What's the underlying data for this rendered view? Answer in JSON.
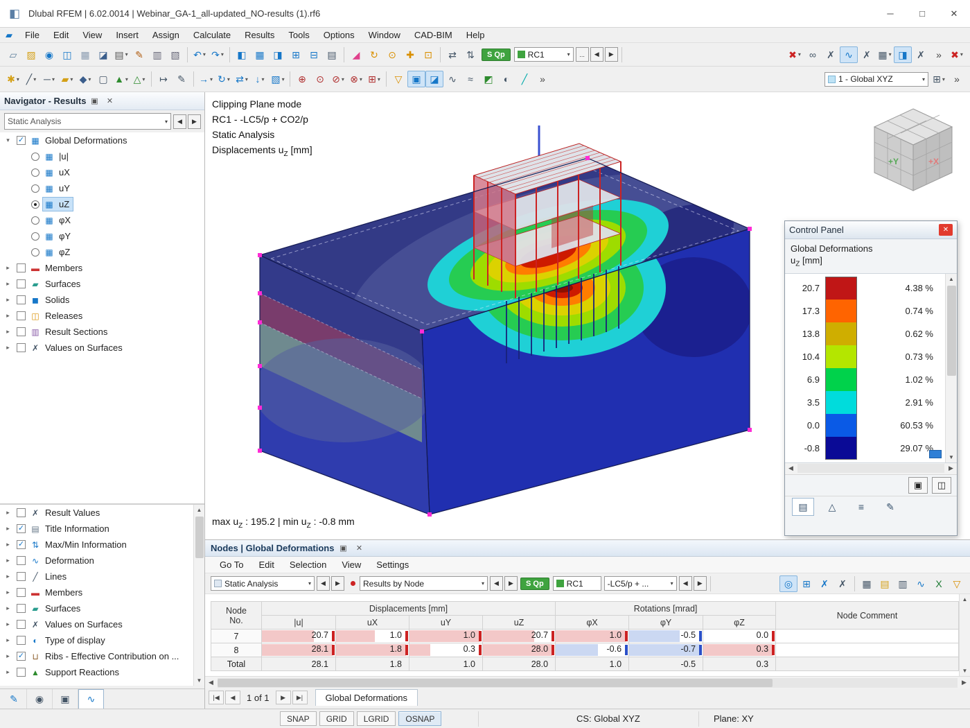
{
  "window": {
    "title": "Dlubal RFEM | 6.02.0014 | Webinar_GA-1_all-updated_NO-results (1).rf6",
    "minimize": "─",
    "maximize": "□",
    "close": "✕"
  },
  "menus": [
    "File",
    "Edit",
    "View",
    "Insert",
    "Assign",
    "Calculate",
    "Results",
    "Tools",
    "Options",
    "Window",
    "CAD-BIM",
    "Help"
  ],
  "toolbar_widgets": {
    "sqp": "S Qp",
    "rc1": "RC1",
    "ellipsis": "...",
    "prev": "◀",
    "next": "▶",
    "gxyz": "1 - Global XYZ"
  },
  "toolbar1a": [
    {
      "name": "new-model-icon",
      "glyph": "▱",
      "color": "#5a7d9a"
    },
    {
      "name": "open-model-icon",
      "glyph": "▨",
      "color": "#d4a017"
    },
    {
      "name": "dlubal-connect-icon",
      "glyph": "◉",
      "color": "#1677c8"
    },
    {
      "name": "model-manager-icon",
      "glyph": "◫",
      "color": "#1677c8"
    },
    {
      "name": "printout-gallery-icon",
      "glyph": "▦",
      "color": "#8a9bb0"
    },
    {
      "name": "save-icon",
      "glyph": "◪",
      "color": "#3b5e8c"
    },
    {
      "name": "print-icon",
      "glyph": "▤",
      "color": "#555555",
      "dd": true
    },
    {
      "name": "edit-report-icon",
      "glyph": "✎",
      "color": "#b05c10"
    },
    {
      "name": "printout-report-icon",
      "glyph": "▥",
      "color": "#666677"
    },
    {
      "name": "report-preview-icon",
      "glyph": "▧",
      "color": "#666677"
    },
    {
      "sep": true
    },
    {
      "name": "undo-icon",
      "glyph": "↶",
      "color": "#1677c8",
      "dd": true
    },
    {
      "name": "redo-icon",
      "glyph": "↷",
      "color": "#1677c8",
      "dd": true
    },
    {
      "sep": true
    },
    {
      "name": "navigator-panel-icon",
      "glyph": "◧",
      "color": "#1677c8"
    },
    {
      "name": "tables-panel-icon",
      "glyph": "▦",
      "color": "#1677c8"
    },
    {
      "name": "side-panel-icon",
      "glyph": "◨",
      "color": "#1677c8"
    },
    {
      "name": "result-tables-icon",
      "glyph": "⊞",
      "color": "#1677c8"
    },
    {
      "name": "sc-tables-icon",
      "glyph": "⊟",
      "color": "#1677c8"
    },
    {
      "name": "all-tables-icon",
      "glyph": "▤",
      "color": "#445566"
    },
    {
      "sep": true
    },
    {
      "name": "clip-select-icon",
      "glyph": "◢",
      "color": "#e0418c"
    },
    {
      "name": "rotate-view-icon",
      "glyph": "↻",
      "color": "#d98f00"
    },
    {
      "name": "zoom-view-icon",
      "glyph": "⊙",
      "color": "#d98f00"
    },
    {
      "name": "pan-view-icon",
      "glyph": "✚",
      "color": "#d98f00"
    },
    {
      "name": "zoom-window-icon",
      "glyph": "⊡",
      "color": "#d98f00"
    },
    {
      "sep": true
    },
    {
      "name": "renumber-icon",
      "glyph": "⇄",
      "color": "#445566"
    },
    {
      "name": "generate-numbering-icon",
      "glyph": "⇅",
      "color": "#445566"
    }
  ],
  "toolbar1b": [
    {
      "name": "delete-results-icon",
      "glyph": "✖",
      "color": "#cc2222",
      "dd": true
    },
    {
      "name": "calculation-link-icon",
      "glyph": "∞",
      "color": "#445566"
    },
    {
      "name": "result-values-xxx-icon",
      "glyph": "✗",
      "color": "#445566"
    },
    {
      "name": "show-results-icon",
      "glyph": "∿",
      "color": "#1677c8",
      "active": true
    },
    {
      "name": "result-xxx-icon",
      "glyph": "✗",
      "color": "#445566"
    },
    {
      "name": "result-grid-icon",
      "glyph": "▦",
      "color": "#445566",
      "dd": true
    },
    {
      "name": "show-panel-icon",
      "glyph": "◨",
      "color": "#1677c8",
      "active": true
    },
    {
      "name": "values-xxx-icon",
      "glyph": "✗",
      "color": "#445566"
    },
    {
      "name": "toolbar-overflow-icon",
      "glyph": "»",
      "color": "#444444"
    },
    {
      "name": "stop-calculation-icon",
      "glyph": "✖",
      "color": "#cc2222",
      "dd": true
    }
  ],
  "toolbar2a": [
    {
      "name": "new-node-icon",
      "glyph": "✱",
      "color": "#d4a017",
      "dd": true
    },
    {
      "name": "new-line-icon",
      "glyph": "╱",
      "color": "#445566",
      "dd": true
    },
    {
      "name": "new-member-icon",
      "glyph": "─",
      "color": "#445566",
      "dd": true
    },
    {
      "name": "new-surface-icon",
      "glyph": "▰",
      "color": "#d4a017",
      "dd": true
    },
    {
      "name": "new-solid-icon",
      "glyph": "◆",
      "color": "#3b5e8c",
      "dd": true
    },
    {
      "name": "new-opening-icon",
      "glyph": "▢",
      "color": "#445566"
    },
    {
      "name": "new-support-icon",
      "glyph": "▲",
      "color": "#2e8b2e",
      "dd": true
    },
    {
      "name": "new-hinge-icon",
      "glyph": "△",
      "color": "#2e8b2e",
      "dd": true
    },
    {
      "sep": true
    },
    {
      "name": "dimension-icon",
      "glyph": "↦",
      "color": "#445566"
    },
    {
      "name": "annotation-icon",
      "glyph": "✎",
      "color": "#445566"
    },
    {
      "sep": true
    },
    {
      "name": "move-copy-icon",
      "glyph": "→",
      "color": "#1677c8",
      "dd": true
    },
    {
      "name": "rotate-icon",
      "glyph": "↻",
      "color": "#1677c8",
      "dd": true
    },
    {
      "name": "mirror-icon",
      "glyph": "⇄",
      "color": "#1677c8",
      "dd": true
    },
    {
      "name": "project-icon",
      "glyph": "↓",
      "color": "#1677c8",
      "dd": true
    },
    {
      "name": "extrude-icon",
      "glyph": "▧",
      "color": "#1677c8",
      "dd": true
    },
    {
      "sep": true
    },
    {
      "name": "snap-nodes-icon",
      "glyph": "⊕",
      "color": "#b03030"
    },
    {
      "name": "merge-nodes-icon",
      "glyph": "⊙",
      "color": "#b03030"
    },
    {
      "name": "divide-lines-icon",
      "glyph": "⊘",
      "color": "#b03030",
      "dd": true
    },
    {
      "name": "intersect-icon",
      "glyph": "⊗",
      "color": "#b03030",
      "dd": true
    },
    {
      "name": "connect-members-icon",
      "glyph": "⊞",
      "color": "#b03030",
      "dd": true
    },
    {
      "sep": true
    },
    {
      "name": "visibility-filter-icon",
      "glyph": "▽",
      "color": "#d98f00"
    },
    {
      "name": "clipping-box-icon",
      "glyph": "▣",
      "color": "#1677c8",
      "active": true
    },
    {
      "name": "clipping-plane-icon",
      "glyph": "◪",
      "color": "#1677c8",
      "active": true
    },
    {
      "name": "result-diagrams-icon",
      "glyph": "∿",
      "color": "#445566"
    },
    {
      "name": "smooth-contours-icon",
      "glyph": "≈",
      "color": "#445566"
    },
    {
      "name": "rendering-icon",
      "glyph": "◩",
      "color": "#2e8b2e"
    },
    {
      "name": "display-settings-icon",
      "glyph": "◐",
      "color": "#445566"
    },
    {
      "name": "paintbrush-icon",
      "glyph": "╱",
      "color": "#00aaaa"
    },
    {
      "name": "toolbar2-overflow-icon",
      "glyph": "»",
      "color": "#444444"
    }
  ],
  "toolbar2b": [
    {
      "name": "visual-objects-icon",
      "glyph": "⊞",
      "color": "#445566",
      "dd": true
    },
    {
      "name": "toolbar2-overflow2-icon",
      "glyph": "»",
      "color": "#444444"
    }
  ],
  "navigator": {
    "title": "Navigator - Results",
    "combo": "Static Analysis",
    "tree": [
      {
        "label": "Global Deformations",
        "expanded": true,
        "checked": true,
        "icon": "▦",
        "icolor": "#1677c8",
        "children": [
          {
            "label": "|u|",
            "radio": false
          },
          {
            "label": "uX",
            "radio": false
          },
          {
            "label": "uY",
            "radio": false
          },
          {
            "label": "uZ",
            "radio": true,
            "selected": true
          },
          {
            "label": "φX",
            "radio": false
          },
          {
            "label": "φY",
            "radio": false
          },
          {
            "label": "φZ",
            "radio": false
          }
        ]
      },
      {
        "label": "Members",
        "checked": false,
        "icon": "▬",
        "icolor": "#cc3333"
      },
      {
        "label": "Surfaces",
        "checked": false,
        "icon": "▰",
        "icolor": "#2a9d8f"
      },
      {
        "label": "Solids",
        "checked": false,
        "icon": "◼",
        "icolor": "#1677c8"
      },
      {
        "label": "Releases",
        "checked": false,
        "icon": "◫",
        "icolor": "#d98f00"
      },
      {
        "label": "Result Sections",
        "checked": false,
        "icon": "▥",
        "icolor": "#8a5ca8"
      },
      {
        "label": "Values on Surfaces",
        "checked": false,
        "icon": "✗",
        "icolor": "#445566"
      }
    ],
    "tree2": [
      {
        "label": "Result Values",
        "checked": false,
        "icon": "✗",
        "icolor": "#445566"
      },
      {
        "label": "Title Information",
        "checked": true,
        "icon": "▤",
        "icolor": "#667788"
      },
      {
        "label": "Max/Min Information",
        "checked": true,
        "icon": "⇅",
        "icolor": "#1677c8"
      },
      {
        "label": "Deformation",
        "checked": false,
        "icon": "∿",
        "icolor": "#1677c8"
      },
      {
        "label": "Lines",
        "checked": false,
        "icon": "╱",
        "icolor": "#445566"
      },
      {
        "label": "Members",
        "checked": false,
        "icon": "▬",
        "icolor": "#cc3333"
      },
      {
        "label": "Surfaces",
        "checked": false,
        "icon": "▰",
        "icolor": "#2a9d8f"
      },
      {
        "label": "Values on Surfaces",
        "checked": false,
        "icon": "✗",
        "icolor": "#445566"
      },
      {
        "label": "Type of display",
        "checked": false,
        "icon": "◐",
        "icolor": "#1677c8"
      },
      {
        "label": "Ribs - Effective Contribution on ...",
        "checked": true,
        "icon": "⊔",
        "icolor": "#8a5c28"
      },
      {
        "label": "Support Reactions",
        "checked": false,
        "icon": "▲",
        "icolor": "#2e8b2e"
      }
    ],
    "tabs": [
      {
        "name": "data-navigator-tab",
        "glyph": "✎",
        "color": "#1677c8"
      },
      {
        "name": "display-navigator-tab",
        "glyph": "◉",
        "color": "#445566"
      },
      {
        "name": "views-navigator-tab",
        "glyph": "▣",
        "color": "#445566"
      },
      {
        "name": "results-navigator-tab",
        "glyph": "∿",
        "color": "#1677c8",
        "active": true
      }
    ]
  },
  "viewport": {
    "info1": "Clipping Plane mode",
    "info2": "RC1 - -LC5/p + CO2/p",
    "info3": "Static Analysis",
    "info4_pre": "Displacements u",
    "info4_sub": "Z",
    "info4_post": " [mm]",
    "max_pre": "max u",
    "max_sub": "Z",
    "max_mid": " : 195.2 | min u",
    "max_sub2": "Z",
    "max_post": " : -0.8 mm",
    "cube_x": "+X",
    "cube_y": "+Y"
  },
  "control_panel": {
    "title": "Control Panel",
    "subtitle1": "Global Deformations",
    "subtitle2_pre": "u",
    "subtitle2_sub": "Z",
    "subtitle2_post": " [mm]",
    "scale": [
      {
        "value": "20.7",
        "color": "#c01616",
        "percent": "4.38 %"
      },
      {
        "value": "17.3",
        "color": "#ff6400",
        "percent": "0.74 %"
      },
      {
        "value": "13.8",
        "color": "#cfae00",
        "percent": "0.62 %"
      },
      {
        "value": "10.4",
        "color": "#b4e600",
        "percent": "0.73 %"
      },
      {
        "value": "6.9",
        "color": "#00d24b",
        "percent": "1.02 %"
      },
      {
        "value": "3.5",
        "color": "#00dcdc",
        "percent": "2.91 %"
      },
      {
        "value": "0.0",
        "color": "#0a5ae6",
        "percent": "60.53 %"
      },
      {
        "value": "-0.8",
        "color": "#0a0a96",
        "percent": "29.07 %"
      }
    ],
    "buttons": [
      {
        "name": "copy-panel-icon",
        "glyph": "▣"
      },
      {
        "name": "panel-options-icon",
        "glyph": "◫"
      }
    ],
    "tabs": [
      {
        "name": "color-scale-tab",
        "glyph": "▤",
        "active": true
      },
      {
        "name": "factors-tab",
        "glyph": "△"
      },
      {
        "name": "filter-tab",
        "glyph": "≡"
      },
      {
        "name": "edit-scale-tab",
        "glyph": "✎"
      }
    ]
  },
  "table_panel": {
    "title": "Nodes | Global Deformations",
    "menu": [
      "Go To",
      "Edit",
      "Selection",
      "View",
      "Settings"
    ],
    "combo1": "Static Analysis",
    "combo2": "Results by Node",
    "badge": "S Qp",
    "combo3": "RC1",
    "combo4": "-LC5/p + ...",
    "toolbar_icons": [
      {
        "name": "find-node-icon",
        "glyph": "◎",
        "color": "#1677c8",
        "active": true
      },
      {
        "name": "sync-views-icon",
        "glyph": "⊞",
        "color": "#1677c8"
      },
      {
        "name": "show-values-icon",
        "glyph": "✗",
        "color": "#1677c8"
      },
      {
        "name": "xxx-values-icon",
        "glyph": "✗",
        "color": "#445566"
      },
      {
        "sep": true
      },
      {
        "name": "table-settings-icon",
        "glyph": "▦",
        "color": "#445566"
      },
      {
        "name": "table-colors-icon",
        "glyph": "▤",
        "color": "#d4a017"
      },
      {
        "name": "table-print-icon",
        "glyph": "▥",
        "color": "#445566"
      },
      {
        "name": "table-diagram-icon",
        "glyph": "∿",
        "color": "#1677c8"
      },
      {
        "name": "export-excel-icon",
        "glyph": "X",
        "color": "#1e7b34"
      },
      {
        "name": "table-filter-icon",
        "glyph": "▽",
        "color": "#d98f00"
      }
    ],
    "headers": {
      "node": "Node",
      "no": "No.",
      "displacements": "Displacements [mm]",
      "rotations": "Rotations [mrad]",
      "comment": "Node Comment",
      "cols": [
        "|u|",
        "uX",
        "uY",
        "uZ",
        "φX",
        "φY",
        "φZ"
      ]
    },
    "rows": [
      {
        "no": "7",
        "values": [
          20.7,
          1.0,
          1.0,
          20.7,
          1.0,
          -0.5,
          0.0
        ],
        "display": [
          "20.7",
          "1.0",
          "1.0",
          "20.7",
          "1.0",
          "-0.5",
          "0.0"
        ]
      },
      {
        "no": "8",
        "values": [
          28.1,
          1.8,
          0.3,
          28.0,
          -0.6,
          -0.7,
          0.3
        ],
        "display": [
          "28.1",
          "1.8",
          "0.3",
          "28.0",
          "-0.6",
          "-0.7",
          "0.3"
        ]
      }
    ],
    "total": {
      "label": "Total",
      "display": [
        "28.1",
        "1.8",
        "1.0",
        "28.0",
        "1.0",
        "-0.5",
        "0.3"
      ]
    },
    "pager": {
      "first": "|◀",
      "prev": "◀",
      "label": "1 of 1",
      "next": "▶",
      "last": "▶|"
    },
    "tab": "Global Deformations"
  },
  "statusbar": {
    "toggles": [
      "SNAP",
      "GRID",
      "LGRID",
      "OSNAP"
    ],
    "cs": "CS: Global XYZ",
    "plane": "Plane: XY"
  }
}
